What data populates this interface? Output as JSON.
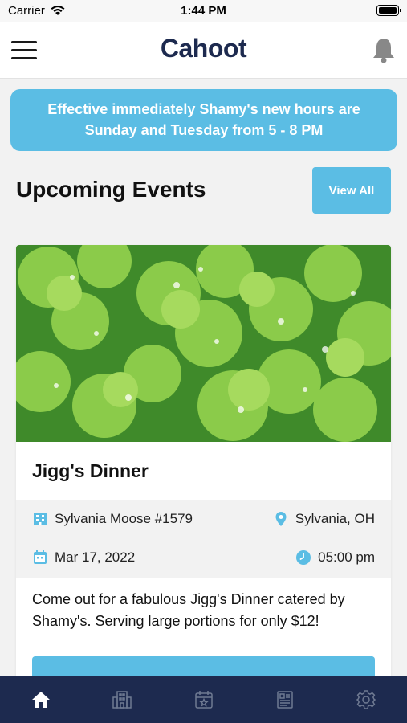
{
  "status_bar": {
    "carrier": "Carrier",
    "time": "1:44 PM"
  },
  "header": {
    "logo": "Cahoot"
  },
  "announcement": {
    "line1": "Effective immediately Shamy's new hours are",
    "line2": "Sunday and Tuesday from 5 - 8 PM"
  },
  "events_section": {
    "title": "Upcoming Events",
    "view_all_label": "View All"
  },
  "event": {
    "title": "Jigg's Dinner",
    "venue": "Sylvania Moose #1579",
    "location": "Sylvania, OH",
    "date": "Mar 17, 2022",
    "time": "05:00 pm",
    "description": "Come out for a fabulous Jigg's Dinner catered by Shamy's. Serving large portions for only $12!",
    "image": "clover-leaves-photo"
  },
  "tabs": [
    {
      "icon": "home-icon",
      "active": true
    },
    {
      "icon": "building-icon",
      "active": false
    },
    {
      "icon": "calendar-star-icon",
      "active": false
    },
    {
      "icon": "newspaper-icon",
      "active": false
    },
    {
      "icon": "gear-icon",
      "active": false
    }
  ],
  "colors": {
    "accent": "#5bbde4",
    "navy": "#1d2a4f"
  }
}
